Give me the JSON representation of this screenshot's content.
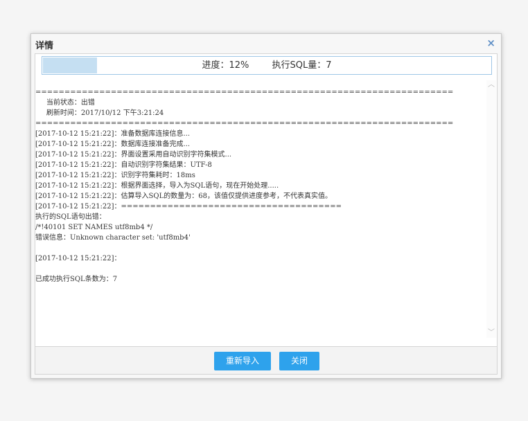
{
  "dialog": {
    "title": "详情",
    "close_icon": "×"
  },
  "progress": {
    "percent": 12,
    "text": "进度：12%        执行SQL量：7"
  },
  "log_lines": [
    "========================================================================",
    "     当前状态：出错",
    "     刷新时间：2017/10/12 下午3:21:24",
    "========================================================================",
    "[2017-10-12 15:21:22]：准备数据库连接信息...",
    "[2017-10-12 15:21:22]：数据库连接准备完成...",
    "[2017-10-12 15:21:22]：界面设置采用自动识别字符集模式...",
    "[2017-10-12 15:21:22]：自动识别字符集结果：UTF-8",
    "[2017-10-12 15:21:22]：识别字符集耗时：18ms",
    "[2017-10-12 15:21:22]：根据界面选择，导入为SQL语句，现在开始处理.....",
    "[2017-10-12 15:21:22]：估算导入SQL的数量为：68，该值仅提供进度参考，不代表真实值。",
    "[2017-10-12 15:21:22]：======================================",
    "执行的SQL语句出错：",
    "/*!40101 SET NAMES utf8mb4 */",
    "错误信息：Unknown character set: 'utf8mb4'",
    "",
    "[2017-10-12 15:21:22]：",
    "",
    "已成功执行SQL条数为：7"
  ],
  "scrollbar": {
    "up_icon": "︿",
    "down_icon": "﹀"
  },
  "footer": {
    "reimport_label": "重新导入",
    "close_label": "关闭"
  },
  "colors": {
    "button": "#2ea2ec",
    "progress_fill": "#c5dff2",
    "progress_border": "#9ec6e6",
    "close_icon": "#5f8fc6"
  }
}
